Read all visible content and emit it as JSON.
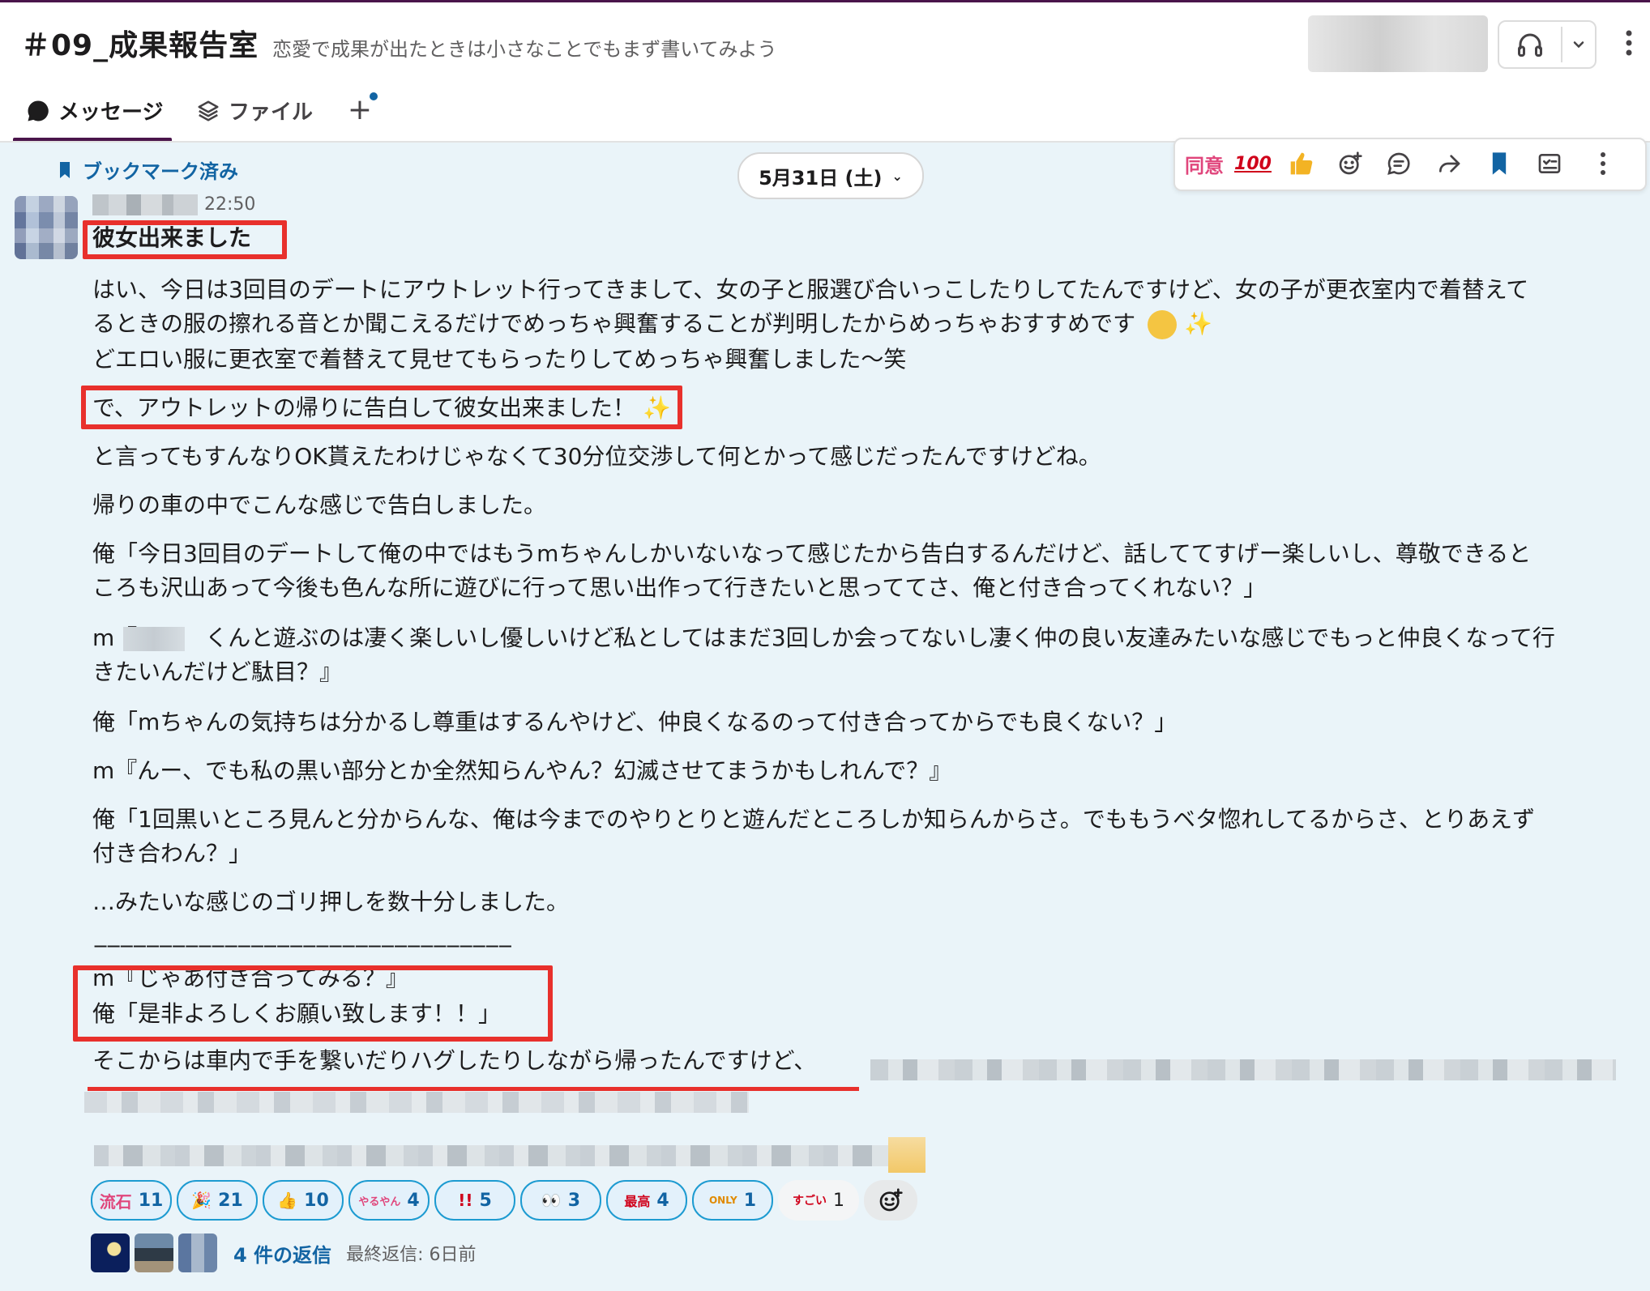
{
  "header": {
    "channel_name": "＃09_成果報告室",
    "channel_description": "恋愛で成果が出たときは小さなことでもまず書いてみよう"
  },
  "tabs": [
    {
      "label": "メッセージ",
      "icon": "message-bubble-icon"
    },
    {
      "label": "ファイル",
      "icon": "layers-icon"
    }
  ],
  "message_area": {
    "bookmark_label": "ブックマーク済み",
    "date_label": "5月31日 (土)",
    "toolbar_icons": [
      "同意-reaction",
      "100-reaction",
      "thumbs-up-reaction",
      "add-reaction-icon",
      "reply-thread-icon",
      "forward-icon",
      "bookmark-icon",
      "save-for-later-icon",
      "more-actions-icon"
    ],
    "toolbar_text": {
      "agree": "同意",
      "hundred": "100"
    }
  },
  "message": {
    "time": "22:50",
    "lines": [
      "彼女出来ました",
      "はい、今日は3回目のデートにアウトレット行ってきまして、女の子と服選び合いっこしたりしてたんですけど、女の子が更衣室内で着替えて",
      "るときの服の擦れる音とか聞こえるだけでめっちゃ興奮することが判明したからめっちゃおすすめです",
      "どエロい服に更衣室で着替えて見せてもらったりしてめっちゃ興奮しました〜笑",
      "で、アウトレットの帰りに告白して彼女出来ました！",
      "と言ってもすんなりOK貰えたわけじゃなくて30分位交渉して何とかって感じだったんですけどね。",
      "帰りの車の中でこんな感じで告白しました。",
      "俺「今日3回目のデートして俺の中ではもうmちゃんしかいないなって感じたから告白するんだけど、話しててすげー楽しいし、尊敬できると",
      "ころも沢山あって今後も色んな所に遊びに行って思い出作って行きたいと思っててさ、俺と付き合ってくれない？」",
      "m『　　　くんと遊ぶのは凄く楽しいし優しいけど私としてはまだ3回しか会ってないし凄く仲の良い友達みたいな感じでもっと仲良くなって行",
      "きたいんだけど駄目？』",
      "俺「mちゃんの気持ちは分かるし尊重はするんやけど、仲良くなるのって付き合ってからでも良くない？」",
      "m『んー、でも私の黒い部分とか全然知らんやん？幻滅させてまうかもしれんで？』",
      "俺「1回黒いところ見んと分からんな、俺は今までのやりとりと遊んだところしか知らんからさ。でももうベタ惚れしてるからさ、とりあえず",
      "付き合わん？」",
      "…みたいな感じのゴリ押しを数十分しました。",
      "−−−−−−−−−−−−−−−−−−−−−−−−−−−−−−−−",
      "m『じゃあ付き合ってみる？』",
      "俺「是非よろしくお願い致します！！」",
      "そこからは車内で手を繋いだりハグしたりしながら帰ったんですけど、"
    ]
  },
  "reactions": [
    {
      "icon": "流石",
      "count": "11",
      "color": "#e0467c"
    },
    {
      "icon": "🎉",
      "count": "21",
      "color": "#d08a00"
    },
    {
      "icon": "👍",
      "count": "10",
      "color": "#f0b400"
    },
    {
      "icon": "やるやん",
      "count": "4",
      "color": "#e0467c"
    },
    {
      "icon": "!!",
      "count": "5",
      "color": "#d0021b"
    },
    {
      "icon": "👀",
      "count": "3",
      "color": "#333"
    },
    {
      "icon": "最高",
      "count": "4",
      "color": "#d0021b"
    },
    {
      "icon": "ONLY",
      "count": "1",
      "color": "#e08a00"
    },
    {
      "icon": "すごい",
      "count": "1",
      "color": "#d0021b"
    }
  ],
  "thread": {
    "reply_count_label": "4 件の返信",
    "last_reply_label": "最終返信: 6日前"
  }
}
